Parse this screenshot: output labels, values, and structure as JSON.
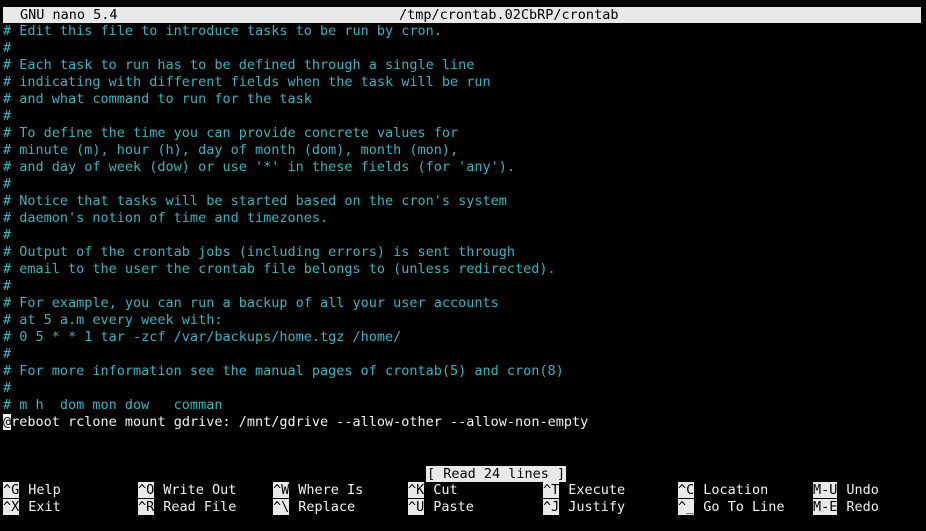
{
  "titlebar": {
    "app": "GNU nano 5.4",
    "file": "/tmp/crontab.02CbRP/crontab"
  },
  "editor": {
    "comment_lines": [
      "# Edit this file to introduce tasks to be run by cron.",
      "#",
      "# Each task to run has to be defined through a single line",
      "# indicating with different fields when the task will be run",
      "# and what command to run for the task",
      "#",
      "# To define the time you can provide concrete values for",
      "# minute (m), hour (h), day of month (dom), month (mon),",
      "# and day of week (dow) or use '*' in these fields (for 'any').",
      "#",
      "# Notice that tasks will be started based on the cron's system",
      "# daemon's notion of time and timezones.",
      "#",
      "# Output of the crontab jobs (including errors) is sent through",
      "# email to the user the crontab file belongs to (unless redirected).",
      "#",
      "# For example, you can run a backup of all your user accounts",
      "# at 5 a.m every week with:",
      "# 0 5 * * 1 tar -zcf /var/backups/home.tgz /home/",
      "#",
      "# For more information see the manual pages of crontab(5) and cron(8)",
      "#",
      "# m h  dom mon dow   comman"
    ],
    "cursor_char": "@",
    "command_rest": "reboot rclone mount gdrive: /mnt/gdrive --allow-other --allow-non-empty"
  },
  "status": "[ Read 24 lines ]",
  "shortcuts": [
    {
      "key": "^G",
      "label": "Help"
    },
    {
      "key": "^X",
      "label": "Exit"
    },
    {
      "key": "^O",
      "label": "Write Out"
    },
    {
      "key": "^R",
      "label": "Read File"
    },
    {
      "key": "^W",
      "label": "Where Is"
    },
    {
      "key": "^\\",
      "label": "Replace"
    },
    {
      "key": "^K",
      "label": "Cut"
    },
    {
      "key": "^U",
      "label": "Paste"
    },
    {
      "key": "^T",
      "label": "Execute"
    },
    {
      "key": "^J",
      "label": "Justify"
    },
    {
      "key": "^C",
      "label": "Location"
    },
    {
      "key": "^_",
      "label": "Go To Line"
    },
    {
      "key": "M-U",
      "label": "Undo"
    },
    {
      "key": "M-E",
      "label": "Redo"
    }
  ],
  "colors": {
    "comment": "#37b4bf",
    "text": "#f2f2f2",
    "bar": "#e9e9e9",
    "background": "#000000"
  }
}
